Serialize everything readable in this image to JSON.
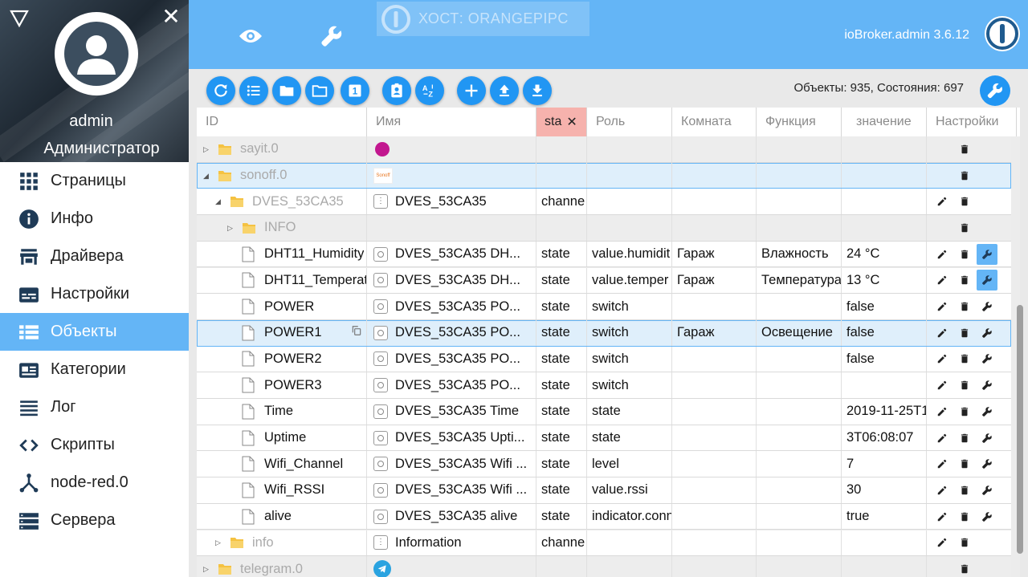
{
  "sidebar": {
    "user_name": "admin",
    "user_role": "Администратор",
    "items": [
      {
        "label": "Страницы",
        "icon": "apps-grid-icon",
        "active": false
      },
      {
        "label": "Инфо",
        "icon": "info-icon",
        "active": false
      },
      {
        "label": "Драйвера",
        "icon": "store-icon",
        "active": false
      },
      {
        "label": "Настройки",
        "icon": "settings-card-icon",
        "active": false
      },
      {
        "label": "Объекты",
        "icon": "list-icon",
        "active": true
      },
      {
        "label": "Категории",
        "icon": "category-card-icon",
        "active": false
      },
      {
        "label": "Лог",
        "icon": "log-lines-icon",
        "active": false
      },
      {
        "label": "Скрипты",
        "icon": "code-brackets-icon",
        "active": false
      },
      {
        "label": "node-red.0",
        "icon": "node-graph-icon",
        "active": false
      },
      {
        "label": "Сервера",
        "icon": "server-icon",
        "active": false
      }
    ]
  },
  "topbar": {
    "host_label": "ХОСТ: ORANGEPIPC",
    "version": "ioBroker.admin 3.6.12"
  },
  "toolbar": {
    "stats": "Объекты: 935, Состояния: 697"
  },
  "table": {
    "columns": {
      "id": "ID",
      "name": "Имя",
      "type_filter": "sta",
      "role": "Роль",
      "room": "Комната",
      "function": "Функция",
      "value": "значение",
      "settings": "Настройки"
    },
    "rows": [
      {
        "id": "sayit.0",
        "name": "",
        "type": "",
        "role": "",
        "room": "",
        "function": "",
        "value": ""
      },
      {
        "id": "sonoff.0",
        "name": "",
        "type": "",
        "role": "",
        "room": "",
        "function": "",
        "value": "",
        "adapter_label": "Sonoff"
      },
      {
        "id": "DVES_53CA35",
        "name": "DVES_53CA35",
        "type": "channe",
        "role": "",
        "room": "",
        "function": "",
        "value": ""
      },
      {
        "id": "INFO",
        "name": "",
        "type": "",
        "role": "",
        "room": "",
        "function": "",
        "value": ""
      },
      {
        "id": "DHT11_Humidity",
        "name": "DVES_53CA35 DH...",
        "type": "state",
        "role": "value.humidit",
        "room": "Гараж",
        "function": "Влажность",
        "value": "24 °C"
      },
      {
        "id": "DHT11_Temperat",
        "name": "DVES_53CA35 DH...",
        "type": "state",
        "role": "value.temper",
        "room": "Гараж",
        "function": "Температура",
        "value": "13 °C"
      },
      {
        "id": "POWER",
        "name": "DVES_53CA35 PO...",
        "type": "state",
        "role": "switch",
        "room": "",
        "function": "",
        "value": "false"
      },
      {
        "id": "POWER1",
        "name": "DVES_53CA35 PO...",
        "type": "state",
        "role": "switch",
        "room": "Гараж",
        "function": "Освещение",
        "value": "false"
      },
      {
        "id": "POWER2",
        "name": "DVES_53CA35 PO...",
        "type": "state",
        "role": "switch",
        "room": "",
        "function": "",
        "value": "false"
      },
      {
        "id": "POWER3",
        "name": "DVES_53CA35 PO...",
        "type": "state",
        "role": "switch",
        "room": "",
        "function": "",
        "value": ""
      },
      {
        "id": "Time",
        "name": "DVES_53CA35 Time",
        "type": "state",
        "role": "state",
        "room": "",
        "function": "",
        "value": "2019-11-25T1"
      },
      {
        "id": "Uptime",
        "name": "DVES_53CA35 Upti...",
        "type": "state",
        "role": "state",
        "room": "",
        "function": "",
        "value": "3T06:08:07"
      },
      {
        "id": "Wifi_Channel",
        "name": "DVES_53CA35 Wifi ...",
        "type": "state",
        "role": "level",
        "room": "",
        "function": "",
        "value": "7"
      },
      {
        "id": "Wifi_RSSI",
        "name": "DVES_53CA35 Wifi ...",
        "type": "state",
        "role": "value.rssi",
        "room": "",
        "function": "",
        "value": "30"
      },
      {
        "id": "alive",
        "name": "DVES_53CA35 alive",
        "type": "state",
        "role": "indicator.conn",
        "room": "",
        "function": "",
        "value": "true"
      },
      {
        "id": "info",
        "name": "Information",
        "type": "channe",
        "role": "",
        "room": "",
        "function": "",
        "value": ""
      },
      {
        "id": "telegram.0",
        "name": "",
        "type": "",
        "role": "",
        "room": "",
        "function": "",
        "value": ""
      }
    ]
  },
  "colors": {
    "primary": "#64b5f6",
    "button": "#2196f3",
    "filter_header": "#f6b2ad",
    "folder": "#f5c242"
  }
}
